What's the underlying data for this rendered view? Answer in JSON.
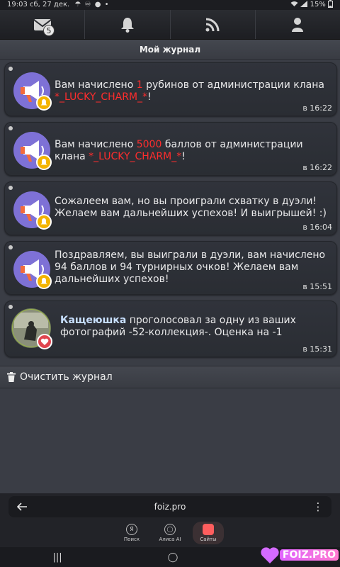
{
  "status_bar": {
    "time_date": "19:03  сб, 27 дек.",
    "left_icons": "☂ ♾ ●  •",
    "right_text": "15%"
  },
  "nav": {
    "messages_badge": "5",
    "icons": [
      "envelope-icon",
      "bell-icon",
      "rss-icon",
      "user-icon"
    ]
  },
  "header": {
    "title": "Мой журнал"
  },
  "journal": [
    {
      "text_before": "Вам начислено ",
      "highlight": "1",
      "text_after": " рубинов от администрации клана ",
      "clan": "*_LUCKY_CHARM_*",
      "tail": "!",
      "time": "в 16:22",
      "avatar": "megaphone",
      "badge_icon": "bell-icon"
    },
    {
      "text_before": "Вам начислено ",
      "highlight": "5000",
      "text_after": " баллов от администрации клана ",
      "clan": "*_LUCKY_CHARM_*",
      "tail": "!",
      "time": "в 16:22",
      "avatar": "megaphone",
      "badge_icon": "bell-icon"
    },
    {
      "text": "Сожалеем вам, но вы проиграли схватку в дуэли! Желаем вам дальнейших успехов! И выигрышей! :)",
      "time": "в 16:04",
      "avatar": "megaphone",
      "badge_icon": "bell-icon"
    },
    {
      "text": "Поздравляем, вы выиграли в дуэли, вам начислено 94 баллов и 94 турнирных очков! Желаем вам дальнейших успехов!",
      "time": "в 15:51",
      "avatar": "megaphone",
      "badge_icon": "bell-icon"
    },
    {
      "author": "Кащеюшка",
      "text": " проголосовал за одну из ваших фотографий -52-коллекция-. Оценка на -1",
      "time": "в 15:31",
      "avatar": "photo",
      "badge_icon": "heart-icon"
    }
  ],
  "clear_button": {
    "label": "Очистить журнал",
    "icon": "trash-icon"
  },
  "browser": {
    "url": "foiz.pro",
    "tabs": [
      {
        "label": "Поиск",
        "glyph": "Я"
      },
      {
        "label": "Алиса AI",
        "glyph": "◯"
      },
      {
        "label": "Сайты",
        "glyph": ""
      }
    ]
  },
  "system_nav": [
    "|||",
    "◯",
    "‹"
  ],
  "watermark": {
    "text": "FOIZ.PRO"
  }
}
